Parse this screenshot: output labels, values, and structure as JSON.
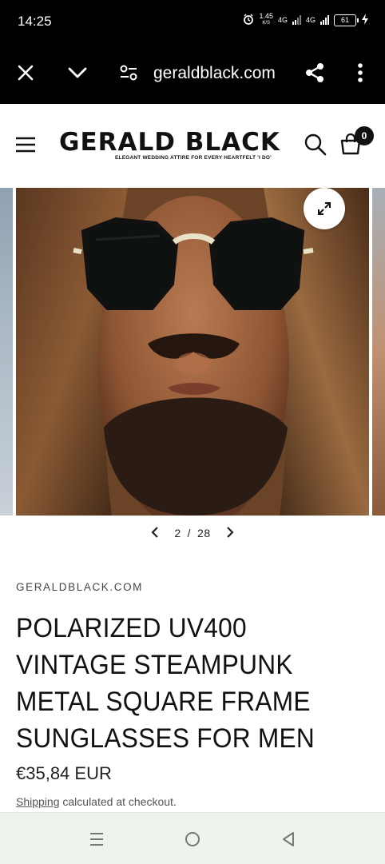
{
  "status_bar": {
    "time": "14:25",
    "net_speed_value": "1.45",
    "net_speed_unit": "K/S",
    "network_1": "4G",
    "network_2": "4G",
    "battery": "61"
  },
  "browser": {
    "url": "geraldblack.com",
    "icons": [
      "close-icon",
      "chevron-down-icon",
      "site-settings-icon",
      "share-icon",
      "more-vert-icon"
    ]
  },
  "header": {
    "logo_text": "GERALD BLACK",
    "logo_tagline": "ELEGANT WEDDING ATTIRE FOR EVERY HEARTFELT 'I DO'",
    "cart_count": "0"
  },
  "gallery": {
    "current": "2",
    "separator": "/",
    "total": "28"
  },
  "product": {
    "vendor": "GERALDBLACK.COM",
    "title": "POLARIZED UV400 VINTAGE STEAMPUNK METAL SQUARE FRAME SUNGLASSES FOR MEN",
    "price": "€35,84 EUR",
    "shipping_link": "Shipping",
    "shipping_rest": " calculated at checkout."
  },
  "colors": {
    "bar_bg": "#000000",
    "text": "#111111",
    "nav_bg": "#eef4ec"
  }
}
